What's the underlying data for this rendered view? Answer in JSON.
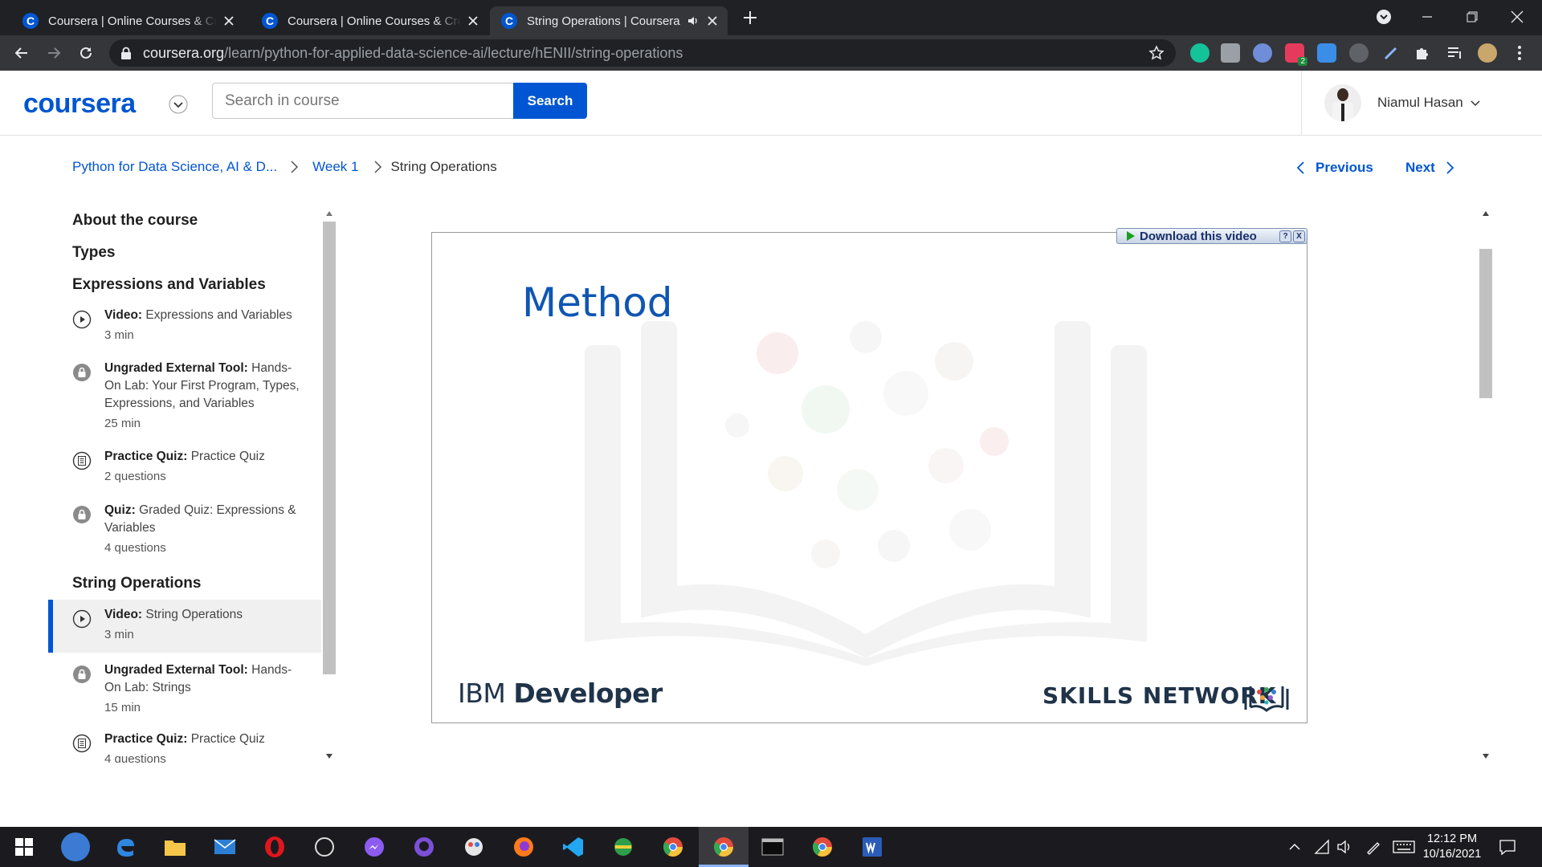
{
  "browser": {
    "tabs": [
      {
        "title": "Coursera | Online Courses & Credentials From Top Educators",
        "favicon": "C"
      },
      {
        "title": "Coursera | Online Courses & Credentials From Top Educators",
        "favicon": "C"
      },
      {
        "title": "String Operations | Coursera",
        "favicon": "C",
        "active": true
      }
    ],
    "url_host": "coursera.org",
    "url_path": "/learn/python-for-applied-data-science-ai/lecture/hENII/string-operations",
    "badge_count": "2"
  },
  "header": {
    "logo": "coursera",
    "search_placeholder": "Search in course",
    "search_button": "Search",
    "user_name": "Niamul Hasan"
  },
  "breadcrumb": {
    "course": "Python for Data Science, AI & D...",
    "week": "Week 1",
    "current": "String Operations"
  },
  "nav": {
    "previous": "Previous",
    "next": "Next"
  },
  "sidebar": {
    "sections": [
      "About the course",
      "Types",
      "Expressions and Variables",
      "String Operations"
    ],
    "items": [
      {
        "type": "Video:",
        "title": "Expressions and Variables",
        "meta": "3 min",
        "icon": "play-icon"
      },
      {
        "type": "Ungraded External Tool:",
        "title": "Hands-On Lab: Your First Program, Types, Expressions, and Variables",
        "meta": "25 min",
        "icon": "lock-icon"
      },
      {
        "type": "Practice Quiz:",
        "title": "Practice Quiz",
        "meta": "2 questions",
        "icon": "quiz-icon"
      },
      {
        "type": "Quiz:",
        "title": "Graded Quiz: Expressions & Variables",
        "meta": "4 questions",
        "icon": "lock-icon"
      },
      {
        "type": "Video:",
        "title": "String Operations",
        "meta": "3 min",
        "icon": "play-icon",
        "active": true
      },
      {
        "type": "Ungraded External Tool:",
        "title": "Hands-On Lab: Strings",
        "meta": "15 min",
        "icon": "lock-icon"
      },
      {
        "type": "Practice Quiz:",
        "title": "Practice Quiz",
        "meta": "4 questions",
        "icon": "quiz-icon"
      }
    ]
  },
  "video": {
    "slide_title": "Method",
    "brand_left_light": "IBM",
    "brand_left_bold": "Developer",
    "brand_right": "SKILLS NETWORK",
    "download_label": "Download this video",
    "help_label": "?",
    "close_label": "X"
  },
  "taskbar": {
    "time": "12:12 PM",
    "date": "10/16/2021"
  },
  "colors": {
    "accent": "#0056d2",
    "chrome_dark": "#202124",
    "chrome_toolbar": "#35363a",
    "taskbar": "#1b1b1f"
  }
}
